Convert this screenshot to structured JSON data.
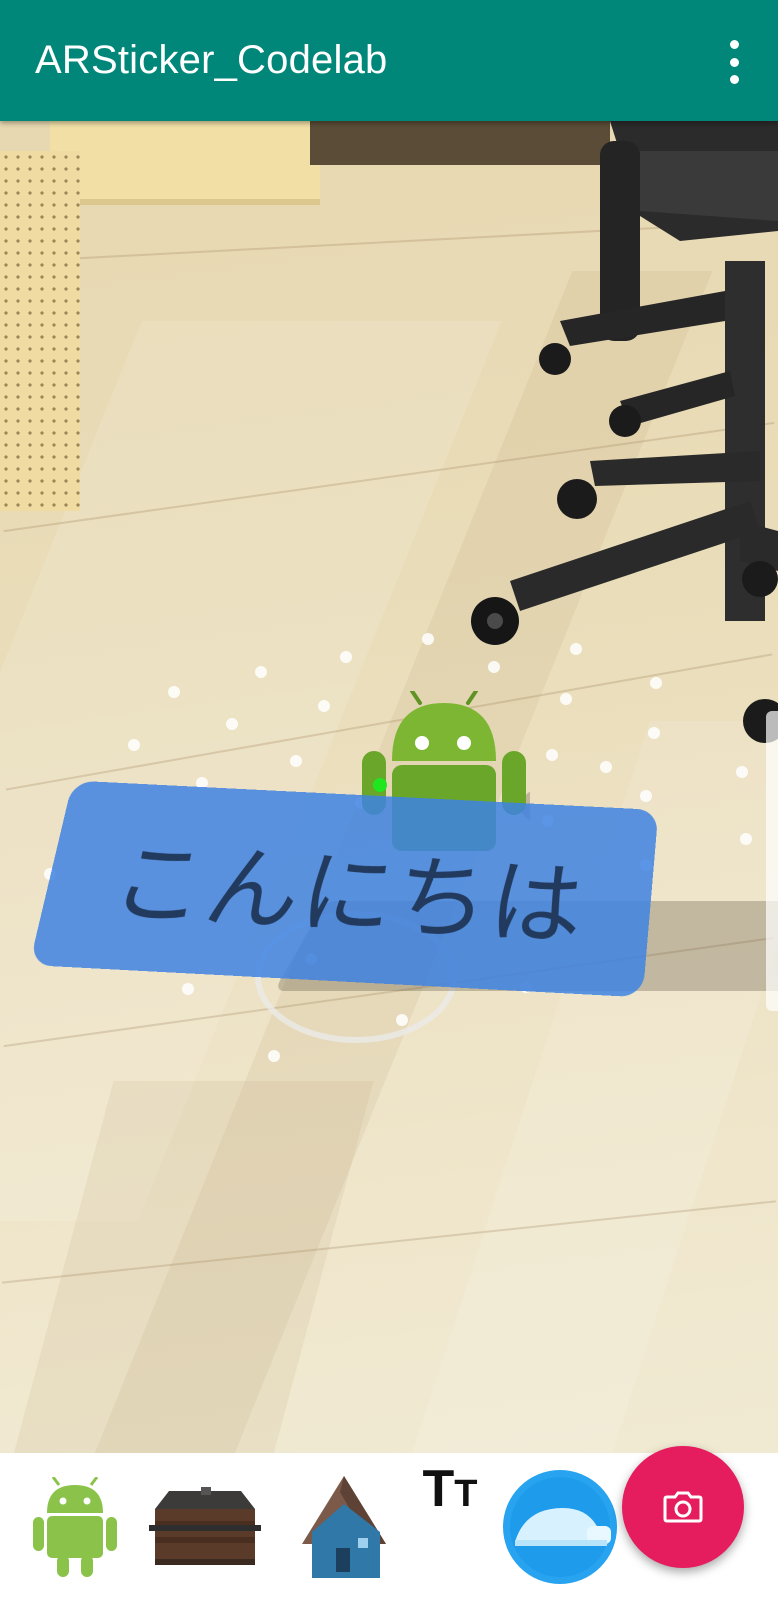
{
  "app_bar": {
    "title": "ARSticker_Codelab",
    "overflow_icon": "more-vert-icon",
    "background_color": "#01877a"
  },
  "scene": {
    "text_sticker": {
      "label": "こんにちは",
      "color": "#3e82e2"
    },
    "android_color": "#7cb632"
  },
  "sticker_tray": {
    "items": [
      {
        "icon": "android-icon"
      },
      {
        "icon": "cabin-icon"
      },
      {
        "icon": "house-icon"
      },
      {
        "icon": "text-tool-icon",
        "glyph_big": "T",
        "glyph_small": "T"
      },
      {
        "icon": "igloo-icon"
      }
    ]
  },
  "fab": {
    "icon": "camera-icon",
    "color": "#e51c5e"
  }
}
